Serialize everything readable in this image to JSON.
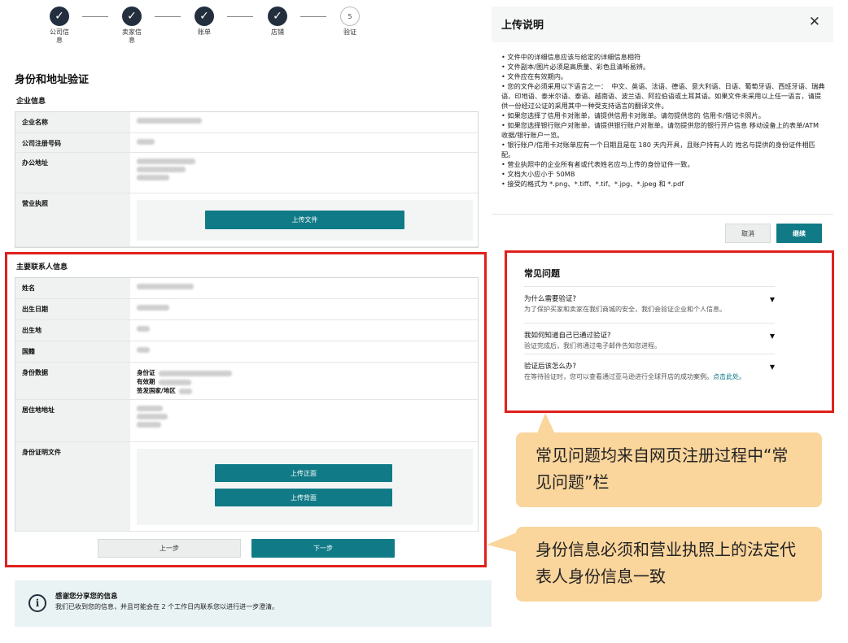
{
  "stepper": {
    "steps": [
      {
        "label": "公司信\n息",
        "done": true
      },
      {
        "label": "卖家信\n息",
        "done": true
      },
      {
        "label": "账单",
        "done": true
      },
      {
        "label": "店铺",
        "done": true
      },
      {
        "label": "验证",
        "done": false,
        "number": "5"
      }
    ],
    "check": "✓"
  },
  "page_title": "身份和地址验证",
  "company": {
    "section_title": "企业信息",
    "fields": {
      "name": "企业名称",
      "reg_no": "公司注册号码",
      "office": "办公地址",
      "license": "营业执照"
    },
    "upload_label": "上传文件"
  },
  "contact": {
    "section_title": "主要联系人信息",
    "fields": {
      "name": "姓名",
      "dob": "出生日期",
      "pob": "出生地",
      "nationality": "国籍",
      "id_data": "身份数据",
      "residence": "居住地地址",
      "id_doc": "身份证明文件"
    },
    "id_lines": [
      "身份证",
      "有效期",
      "签发国家/地区"
    ],
    "upload_front": "上传正面",
    "upload_back": "上传背面",
    "prev": "上一步",
    "next": "下一步"
  },
  "banner": {
    "icon": "i",
    "title": "感谢您分享您的信息",
    "text": "我们已收到您的信息，并且可能会在 2 个工作日内联系您以进行进一步澄清。"
  },
  "modal": {
    "title": "上传说明",
    "close": "✕",
    "items": [
      "• 文件中的详细信息应该与给定的详细信息相符",
      "• 文件副本/图片必须是高质量、彩色且清晰易辨。",
      "• 文件应在有效期内。",
      "• 您的文件必须采用以下语言之一：  中文、英语、法语、德语、意大利语、日语、葡萄牙语、西班牙语、瑞典语、印地语、泰米尔语、泰语、越南语、波兰语、阿拉伯语或土耳其语。如果文件未采用以上任一语言，请提供一份经过公证的采用其中一种受支持语言的翻译文件。",
      "• 如果您选择了信用卡对账单，请提供信用卡对账单。请勿提供您的 信用卡/借记卡照片。",
      "• 如果您选择银行账户对账单，请提供银行账户对账单。请勿提供您的银行开户信息 移动设备上的表单/ATM 收据/银行账户一览。",
      "• 银行账户/信用卡对账单应有一个日期且是在 180 天内开具，且账户持有人的 姓名与提供的身份证件相匹配。",
      "• 营业执照中的企业所有者或代表姓名应与上传的身份证件一致。",
      "• 文档大小应小于 50MB",
      "• 接受的格式为 *.png、*.tiff、*.tif、*.jpg、*.jpeg 和 *.pdf"
    ],
    "cancel": "取消",
    "continue": "继续"
  },
  "faq": {
    "title": "常见问题",
    "items": [
      {
        "q": "为什么需要验证?",
        "a": "为了保护买家和卖家在我们商城的安全，我们会验证企业和个人信息。",
        "link": ""
      },
      {
        "q": "我如何知道自己已通过验证?",
        "a": "验证完成后，我们将通过电子邮件告知您进程。",
        "link": ""
      },
      {
        "q": "验证后该怎么办?",
        "a": "在等待验证时，您可以查看通过亚马逊进行全球开店的成功案例。",
        "link": "点击此处。"
      }
    ],
    "triangle": "▼"
  },
  "callouts": {
    "faq_note": "常见问题均来自网页注册过程中“常见问题”栏",
    "id_note": "身份信息必须和营业执照上的法定代表人身份信息一致"
  },
  "colors": {
    "primary_button": "#107b87",
    "highlight_border": "#e0201c",
    "callout_bg": "#fad59c",
    "stepper_done": "#232f3e"
  }
}
